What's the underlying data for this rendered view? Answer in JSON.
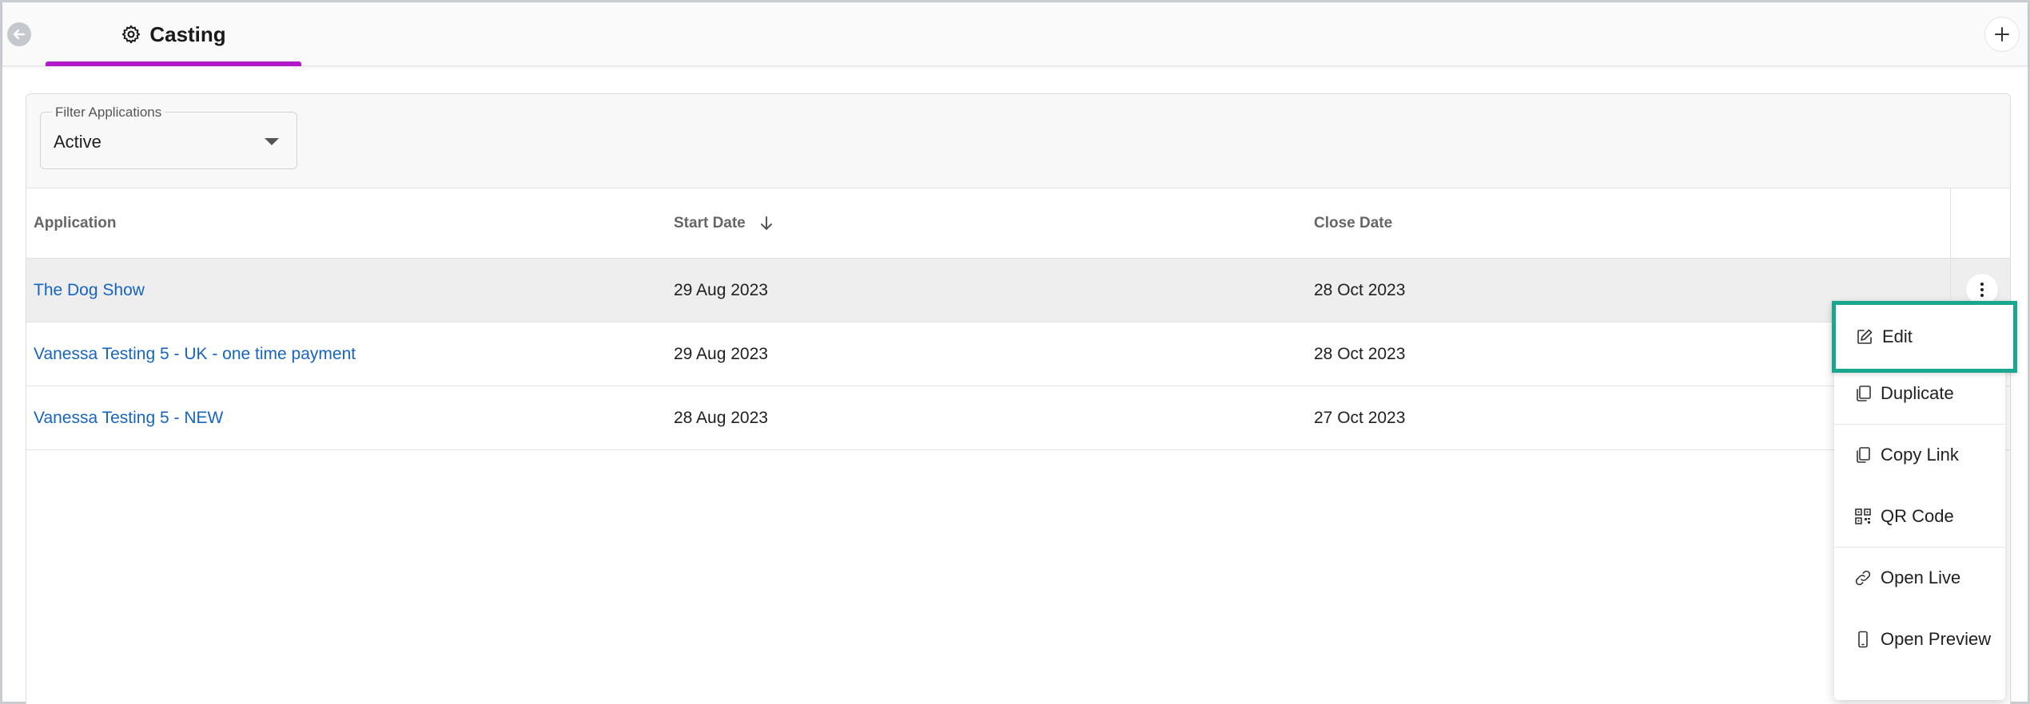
{
  "header": {
    "tab_label": "Casting"
  },
  "filter": {
    "legend": "Filter Applications",
    "value": "Active"
  },
  "table": {
    "columns": [
      "Application",
      "Start Date",
      "Close Date"
    ],
    "sort_column": "Start Date",
    "sort_direction": "descending",
    "rows": [
      {
        "application": "The Dog Show",
        "start": "29 Aug 2023",
        "close": "28 Oct 2023"
      },
      {
        "application": "Vanessa Testing 5 - UK - one time payment",
        "start": "29 Aug 2023",
        "close": "28 Oct 2023"
      },
      {
        "application": "Vanessa Testing 5 - NEW",
        "start": "28 Aug 2023",
        "close": "27 Oct 2023"
      }
    ]
  },
  "menu": {
    "items": [
      "Edit",
      "Duplicate",
      "Copy Link",
      "QR Code",
      "Open Live",
      "Open Preview"
    ]
  },
  "colors": {
    "accent_tab": "#b01ac8",
    "link": "#1565c0",
    "highlight_border": "#19a88e"
  }
}
